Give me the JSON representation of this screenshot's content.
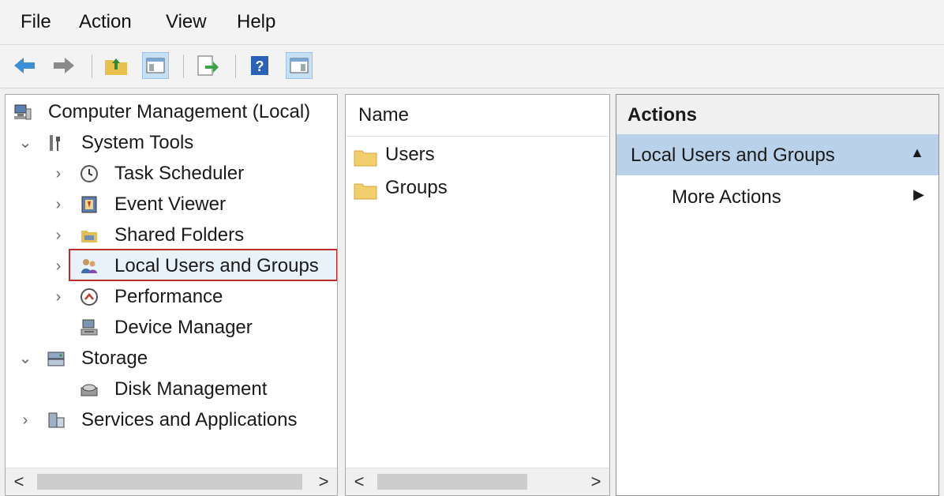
{
  "menu": [
    "File",
    "Action",
    "View",
    "Help"
  ],
  "toolbar": {
    "icons": [
      "back-arrow-icon",
      "forward-arrow-icon",
      "up-folder-icon",
      "show-hide-console-tree-icon",
      "export-list-icon",
      "help-icon",
      "show-hide-action-pane-icon"
    ]
  },
  "tree": {
    "root": "Computer Management (Local)",
    "system_tools": "System Tools",
    "task_scheduler": "Task Scheduler",
    "event_viewer": "Event Viewer",
    "shared_folders": "Shared Folders",
    "local_users": "Local Users and Groups",
    "performance": "Performance",
    "device_manager": "Device Manager",
    "storage": "Storage",
    "disk_management": "Disk Management",
    "services": "Services and Applications"
  },
  "list": {
    "header": "Name",
    "items": [
      "Users",
      "Groups"
    ]
  },
  "actions": {
    "title": "Actions",
    "section": "Local Users and Groups",
    "more": "More Actions"
  },
  "scroll": {
    "left": "<",
    "right": ">"
  },
  "colors": {
    "highlight_border": "#c02b2b",
    "section_bg": "#b9d2ea"
  }
}
